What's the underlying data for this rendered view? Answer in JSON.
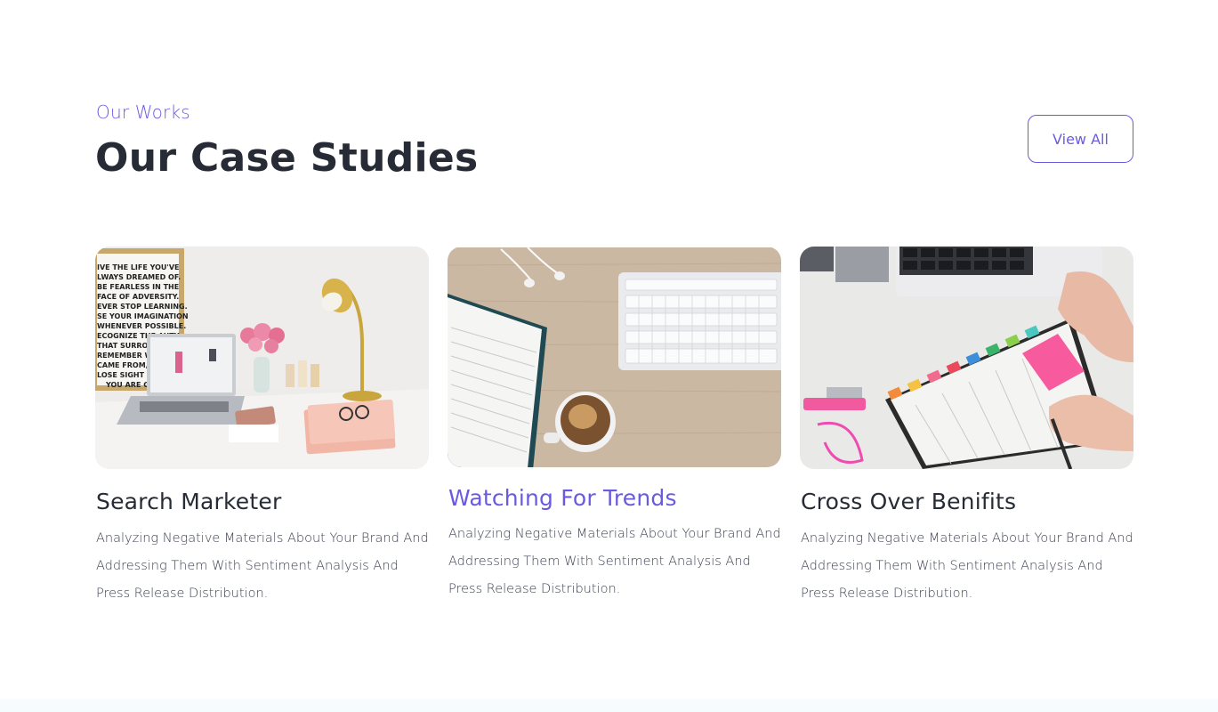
{
  "section": {
    "eyebrow": "Our Works",
    "heading": "Our Case Studies",
    "view_all_label": "View All"
  },
  "cards": [
    {
      "title": "Search Marketer",
      "description": "Analyzing Negative Materials About Your Brand And Addressing Them With Sentiment Analysis And Press Release Distribution.",
      "image": "desk-laptop-lamp-flowers-photo",
      "poster_text": "IVE THE LIFE YOU'VE ALWAYS DREAMED OF. BE FEARLESS IN THE FACE OF ADVERSITY. EVER STOP LEARNING. SE YOUR IMAGINATION WHENEVER POSSIBLE. ECOGNIZE THE AUTY THAT SURROUN REMEMBER WHE CAME FROM, BU LOSE SIGHT OF YOU ARE GO"
    },
    {
      "title": "Watching For Trends",
      "description": "Analyzing Negative Materials About Your Brand And Addressing Them With Sentiment Analysis And Press Release Distribution.",
      "image": "keyboard-notebook-coffee-photo"
    },
    {
      "title": "Cross Over Benifits",
      "description": "Analyzing Negative Materials About Your Brand And Addressing Them With Sentiment Analysis And Press Release Distribution.",
      "image": "laptop-planner-sticky-notes-photo"
    }
  ],
  "colors": {
    "accent": "#6a5ae0",
    "heading": "#262b36",
    "body_text": "#3c4150"
  }
}
